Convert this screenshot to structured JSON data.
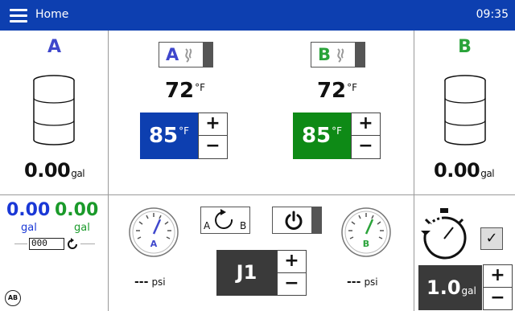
{
  "header": {
    "title": "Home",
    "time": "09:35"
  },
  "tank_a": {
    "letter": "A",
    "color": "#3f47cc",
    "amount": "0.00",
    "unit": "gal"
  },
  "tank_b": {
    "letter": "B",
    "color": "#2aa33a",
    "amount": "0.00",
    "unit": "gal"
  },
  "heater_a": {
    "letter": "A",
    "actual_temp": "72",
    "setpoint": "85",
    "temp_unit": "°F",
    "setpoint_bg": "#0d3fb0",
    "plus": "+",
    "minus": "−"
  },
  "heater_b": {
    "letter": "B",
    "actual_temp": "72",
    "setpoint": "85",
    "temp_unit": "°F",
    "setpoint_bg": "#0e8a16",
    "plus": "+",
    "minus": "−"
  },
  "counters": {
    "a_value": "0.00",
    "b_value": "0.00",
    "a_unit": "gal",
    "b_unit": "gal",
    "counter_digits": "000"
  },
  "pressure": {
    "a_value": "---",
    "b_value": "---",
    "unit": "psi",
    "a_letter": "A",
    "b_letter": "B"
  },
  "recirc": {
    "left_letter": "A",
    "right_letter": "B"
  },
  "job": {
    "label": "J1",
    "plus": "+",
    "minus": "−"
  },
  "timer": {
    "check": "✓",
    "flow_value": "1.0",
    "flow_unit": "gal",
    "plus": "+",
    "minus": "−"
  },
  "footer": {
    "ab_badge": "AB"
  },
  "colors": {
    "header_bg": "#0d3fb0",
    "a_accent": "#3f47cc",
    "b_accent": "#2aa33a"
  }
}
